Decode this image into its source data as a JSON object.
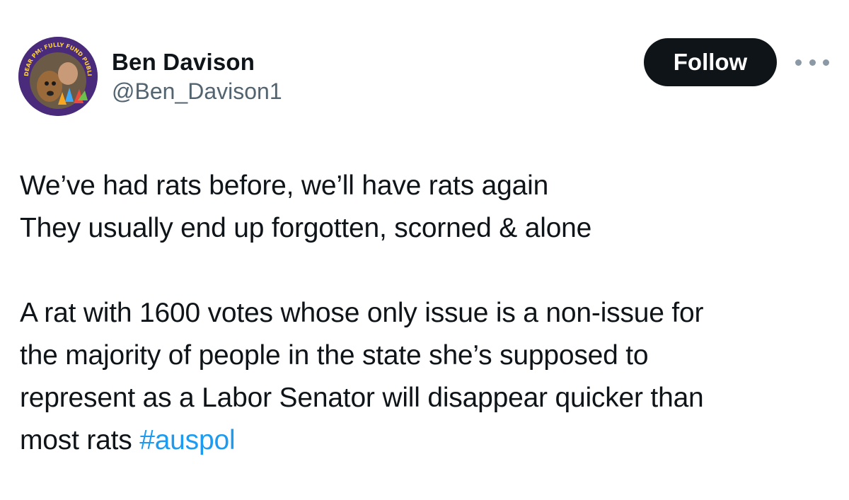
{
  "author": {
    "display_name": "Ben Davison",
    "handle": "@Ben_Davison1",
    "avatar_badge_text": "DEAR PM: FULLY FUND PUBLIC SCHOOLS!"
  },
  "follow_label": "Follow",
  "more_icon": "more-horizontal-icon",
  "tweet": {
    "paragraph1": [
      "We’ve had rats before, we’ll have rats again",
      "They usually end up forgotten, scorned & alone"
    ],
    "paragraph2": [
      "A rat with 1600 votes whose only issue is a non-issue for",
      "the majority of people in the state she’s supposed to",
      "represent as a Labor Senator will disappear quicker than"
    ],
    "last_line_text": "most rats ",
    "hashtag": "#auspol"
  },
  "colors": {
    "text": "#0f1419",
    "secondary": "#536471",
    "link": "#1d9bf0",
    "button_bg": "#0f1419",
    "button_text": "#ffffff",
    "avatar_ring": "#4a2a7a"
  }
}
